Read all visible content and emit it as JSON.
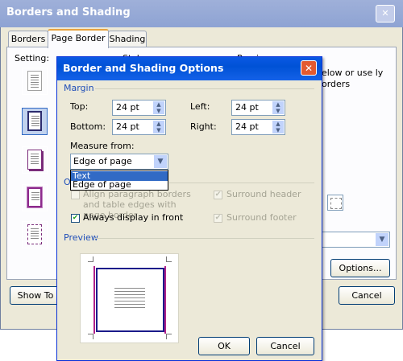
{
  "outer": {
    "title": "Borders and Shading",
    "close_glyph": "✕",
    "tabs": [
      {
        "label": "Borders"
      },
      {
        "label": "Page Border"
      },
      {
        "label": "Shading"
      }
    ],
    "setting_label": "Setting:",
    "style_label": "Style:",
    "preview_label": "Preview",
    "hint_text": "below or use ly borders",
    "options_button": "Options...",
    "show_toolbar_button": "Show To",
    "cancel_button": "Cancel"
  },
  "dialog": {
    "title": "Border and Shading Options",
    "close_glyph": "✕",
    "margin_group": "Margin",
    "top_label": "Top:",
    "top_value": "24 pt",
    "left_label": "Left:",
    "left_value": "24 pt",
    "bottom_label": "Bottom:",
    "bottom_value": "24 pt",
    "right_label": "Right:",
    "right_value": "24 pt",
    "measure_label": "Measure from:",
    "measure_value": "Edge of page",
    "measure_options": [
      {
        "label": "Text",
        "highlighted": true
      },
      {
        "label": "Edge of page",
        "highlighted": false
      }
    ],
    "options_group_partial": "O",
    "align_paragraph_label": "Align paragraph borders and table edges with page border",
    "surround_header_label": "Surround header",
    "always_front_label": "Always display in front",
    "surround_footer_label": "Surround footer",
    "preview_group": "Preview",
    "ok_button": "OK",
    "cancel_button": "Cancel",
    "checks": {
      "align_paragraph": false,
      "surround_header": true,
      "always_front": true,
      "surround_footer": true
    }
  },
  "colors": {
    "title_blue": "#0054e3",
    "group_label": "#1f4eb8",
    "selection": "#316ac5",
    "dialog_bg": "#ece9d8",
    "preview_border": "#1b1b8a",
    "preview_margin_guide": "#b0208a"
  },
  "icons": [
    "setting-none-icon",
    "setting-box-icon",
    "setting-shadow-icon",
    "setting-3d-icon",
    "setting-custom-icon",
    "spin-up-icon",
    "spin-down-icon",
    "dropdown-arrow-icon",
    "close-icon",
    "horizontal-line-icon"
  ]
}
